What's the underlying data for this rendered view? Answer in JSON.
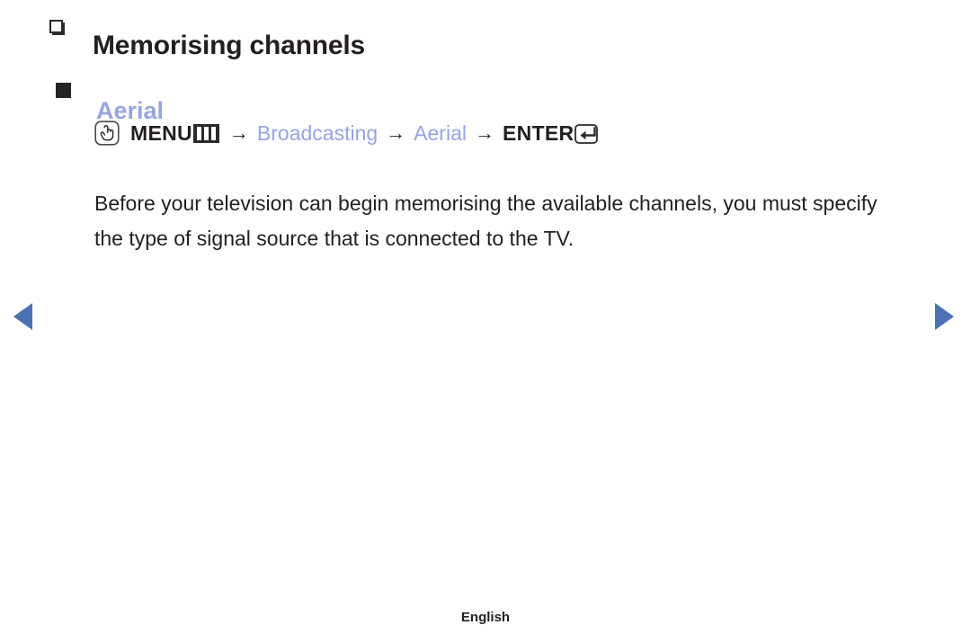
{
  "page": {
    "title": "Memorising channels",
    "section_heading": "Aerial",
    "body_paragraph": "Before your television can begin memorising the available channels, you must specify the type of signal source that is connected to the TV.",
    "footer_language": "English"
  },
  "menu_path": {
    "press_icon": "hand-press-icon",
    "menu_label": "MENU",
    "menu_glyph": "menu-bars-icon",
    "separator": "→",
    "steps": [
      {
        "label": "Broadcasting",
        "highlight": true
      },
      {
        "label": "Aerial",
        "highlight": true
      }
    ],
    "enter_label": "ENTER",
    "enter_glyph": "enter-return-icon"
  },
  "navigation": {
    "prev_label": "previous-page",
    "next_label": "next-page"
  },
  "colors": {
    "accent_link": "#97a4e2",
    "nav_arrow": "#4c71b5",
    "text": "#231f20",
    "background": "#ffffff"
  },
  "bullets": {
    "title_bullet": "hollow-square-bullet",
    "section_bullet": "solid-square-bullet"
  }
}
